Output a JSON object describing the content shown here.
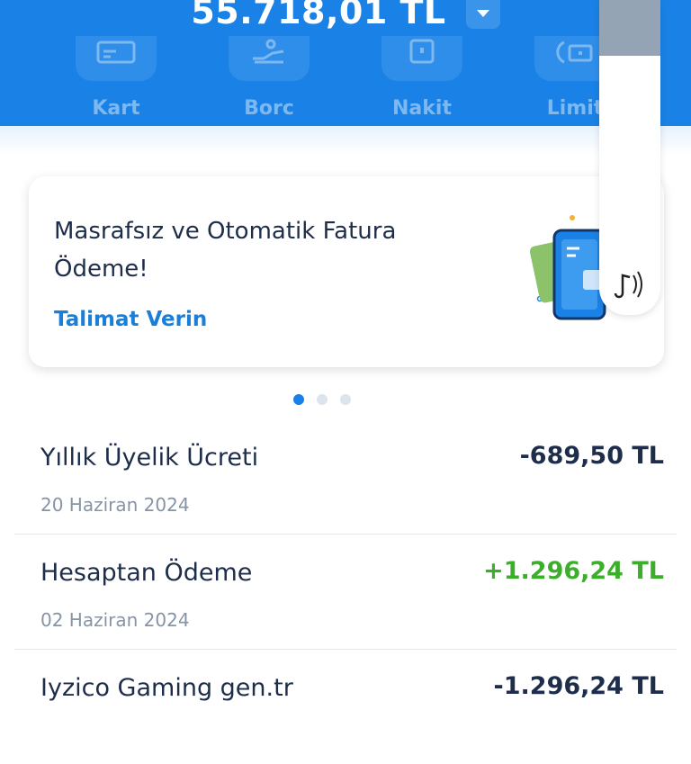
{
  "balance": {
    "amount": "55.718,01 TL"
  },
  "quick_actions": [
    {
      "label": "Kart",
      "icon": "card-icon"
    },
    {
      "label": "Borc",
      "icon": "hand-money-icon"
    },
    {
      "label": "Nakit",
      "icon": "cash-icon"
    },
    {
      "label": "Limit",
      "icon": "limit-card-icon"
    }
  ],
  "promo": {
    "title": "Masrafsız ve Otomatik Fatura Ödeme!",
    "cta": "Talimat Verin",
    "illustration": "phone-bill-illustration"
  },
  "carousel": {
    "count": 3,
    "active": 0
  },
  "transactions": [
    {
      "name": "Yıllık Üyelik Ücreti",
      "date": "20 Haziran 2024",
      "amount": "-689,50 TL",
      "positive": false
    },
    {
      "name": "Hesaptan Ödeme",
      "date": "02 Haziran 2024",
      "amount": "+1.296,24 TL",
      "positive": true
    },
    {
      "name": "Iyzico Gaming gen.tr",
      "date": "",
      "amount": "-1.296,24 TL",
      "positive": false
    }
  ],
  "colors": {
    "brand": "#1a82e6",
    "positive": "#3cae2c",
    "text": "#1d2d4a",
    "muted": "#8594a6"
  }
}
